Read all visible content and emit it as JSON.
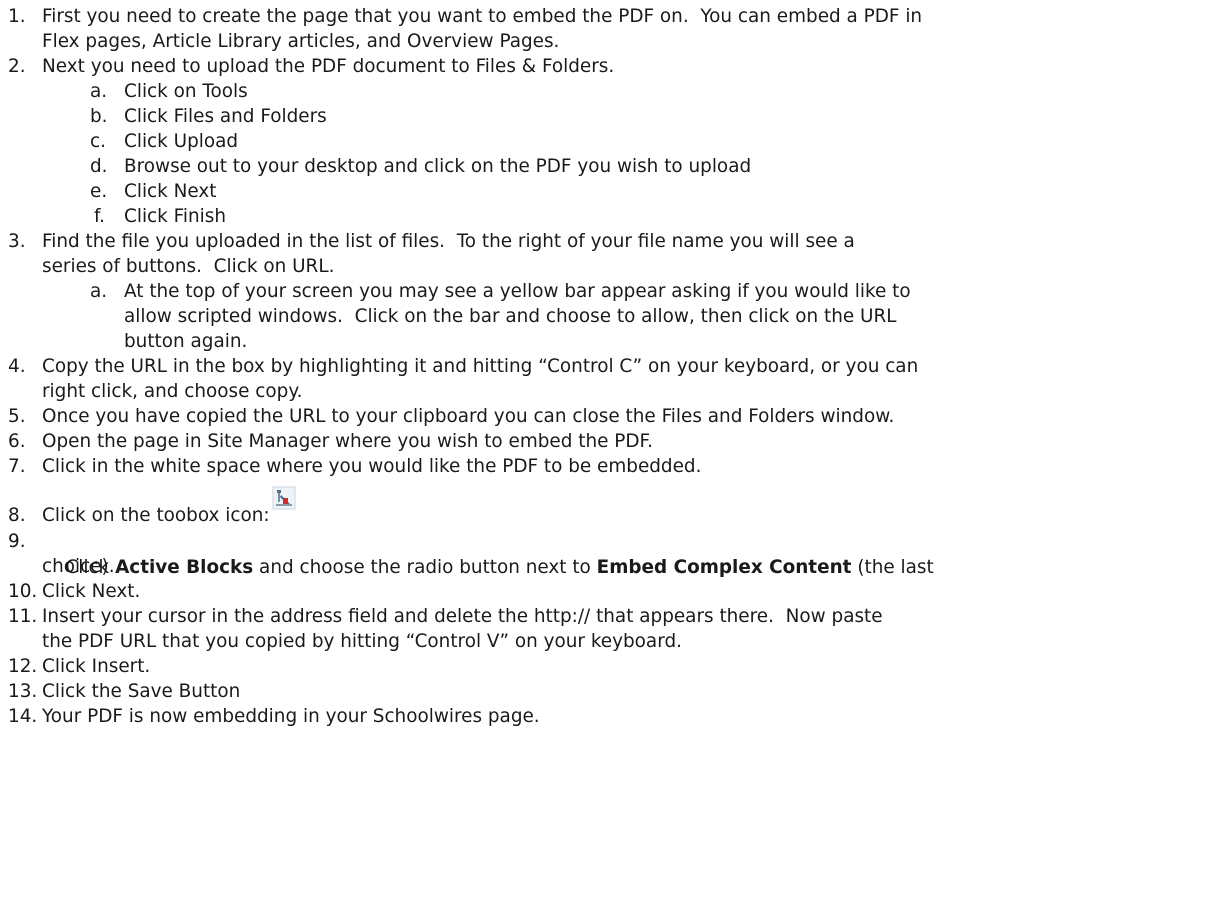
{
  "steps": [
    {
      "num": "1.",
      "lines": [
        "First you need to create the page that you want to embed the PDF on.  You can embed a PDF in",
        "Flex pages, Article Library articles, and Overview Pages."
      ]
    },
    {
      "num": "2.",
      "lines": [
        "Next you need to upload the PDF document to Files & Folders."
      ],
      "substeps": [
        {
          "letter": "a.",
          "lines": [
            "Click on Tools"
          ]
        },
        {
          "letter": "b.",
          "lines": [
            "Click Files and Folders"
          ]
        },
        {
          "letter": "c.",
          "lines": [
            "Click Upload"
          ]
        },
        {
          "letter": "d.",
          "lines": [
            "Browse out to your desktop and click on the PDF you wish to upload"
          ]
        },
        {
          "letter": "e.",
          "lines": [
            "Click Next"
          ]
        },
        {
          "letter": "f.",
          "lines": [
            "Click Finish"
          ]
        }
      ]
    },
    {
      "num": "3.",
      "lines": [
        "Find the file you uploaded in the list of files.  To the right of your file name you will see a",
        "series of buttons.  Click on URL."
      ],
      "substeps": [
        {
          "letter": "a.",
          "lines": [
            "At the top of your screen you may see a yellow bar appear asking if you would like to",
            "allow scripted windows.  Click on the bar and choose to allow, then click on the URL",
            "button again."
          ]
        }
      ]
    },
    {
      "num": "4.",
      "lines": [
        "Copy the URL in the box by highlighting it and hitting “Control C” on your keyboard, or you can",
        "right click, and choose copy."
      ]
    },
    {
      "num": "5.",
      "lines": [
        "Once you have copied the URL to your clipboard you can close the Files and Folders window."
      ]
    },
    {
      "num": "6.",
      "lines": [
        "Open the page in Site Manager where you wish to embed the PDF."
      ]
    },
    {
      "num": "7.",
      "lines": [
        "Click in the white space where you would like the PDF to be embedded."
      ]
    },
    {
      "num": "8.",
      "lines": [
        "Click on the toobox icon: "
      ],
      "icon": "toolbox-icon"
    },
    {
      "num": "9.",
      "rich": [
        {
          "t": "Click "
        },
        {
          "t": "Active Blocks",
          "bold": true
        },
        {
          "t": " and choose the radio button next to "
        },
        {
          "t": "Embed Complex Content",
          "bold": true
        },
        {
          "t": " (the last"
        }
      ],
      "lines": [
        "",
        "choice)."
      ]
    },
    {
      "num": "10.",
      "lines": [
        "Click Next."
      ]
    },
    {
      "num": "11.",
      "lines": [
        "Insert your cursor in the address field and delete the http:// that appears there.  Now paste",
        "the PDF URL that you copied by hitting “Control V” on your keyboard."
      ]
    },
    {
      "num": "12.",
      "lines": [
        "Click Insert."
      ]
    },
    {
      "num": "13.",
      "lines": [
        "Click the Save Button"
      ]
    },
    {
      "num": "14.",
      "lines": [
        "Your PDF is now embedding in your Schoolwires page."
      ]
    }
  ]
}
